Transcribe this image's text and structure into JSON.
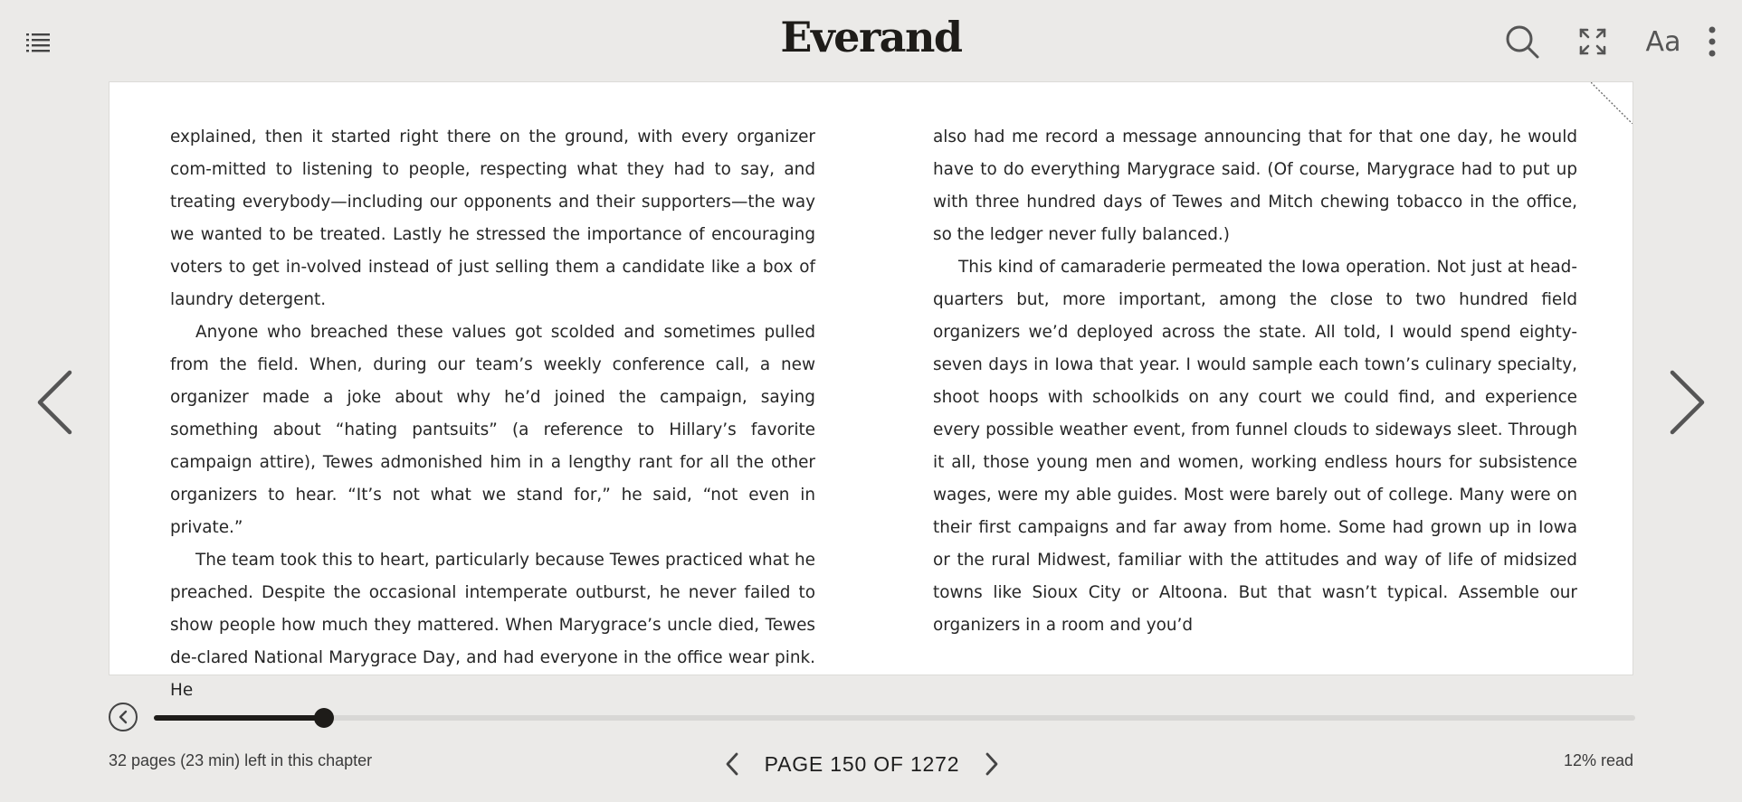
{
  "app": {
    "logo": "Everand"
  },
  "toolbar": {
    "toc_icon": "list-icon",
    "search_icon": "search-icon",
    "fullscreen_icon": "fullscreen-icon",
    "font_settings_label": "Aa",
    "more_icon": "more-vertical-icon"
  },
  "reader": {
    "left_column": [
      "explained, then it started right there on the ground, with every organizer com-mitted to listening to people, respecting what they had to say, and treating everybody—including our opponents and their supporters—the way we wanted to be treated. Lastly he stressed the importance of encouraging voters to get in-volved instead of just selling them a candidate like a box of laundry detergent.",
      "Anyone who breached these values got scolded and sometimes pulled from the field. When, during our team’s weekly conference call, a new organizer made a joke about why he’d joined the campaign, saying something about “hating pantsuits” (a reference to Hillary’s favorite campaign attire), Tewes admonished him in a lengthy rant for all the other organizers to hear. “It’s not what we stand for,” he said, “not even in private.”",
      "The team took this to heart, particularly because Tewes practiced what he preached. Despite the occasional intemperate outburst, he never failed to show people how much they mattered. When Marygrace’s uncle died, Tewes de-clared National Marygrace Day, and had everyone in the office wear pink. He"
    ],
    "right_column": [
      "also had me record a message announcing that for that one day, he would have to do everything Marygrace said. (Of course, Marygrace had to put up with three hundred days of Tewes and Mitch chewing tobacco in the office, so the ledger never fully balanced.)",
      "This kind of camaraderie permeated the Iowa operation. Not just at head-quarters but, more important, among the close to two hundred field organizers we’d deployed across the state. All told, I would spend eighty-seven days in Iowa that year. I would sample each town’s culinary specialty, shoot hoops with schoolkids on any court we could find, and experience every possible weather event, from funnel clouds to sideways sleet. Through it all, those young men and women, working endless hours for subsistence wages, were my able guides. Most were barely out of college. Many were on their first campaigns and far away from home. Some had grown up in Iowa or the rural Midwest, familiar with the attitudes and way of life of midsized towns like Sioux City or Altoona. But that wasn’t typical. Assemble our organizers in a room and you’d"
    ],
    "prev_page_icon": "chevron-left-icon",
    "next_page_icon": "chevron-right-icon"
  },
  "progress": {
    "back_icon": "back-circle-icon",
    "fraction": 0.115,
    "chapter_remaining": "32 pages (23 min) left in this chapter",
    "page_label": "PAGE 150 OF 1272",
    "percent_read": "12% read"
  },
  "colors": {
    "background": "#ebeae8",
    "page": "#ffffff",
    "accent": "#1e1c19",
    "track": "#d8d7d5"
  }
}
